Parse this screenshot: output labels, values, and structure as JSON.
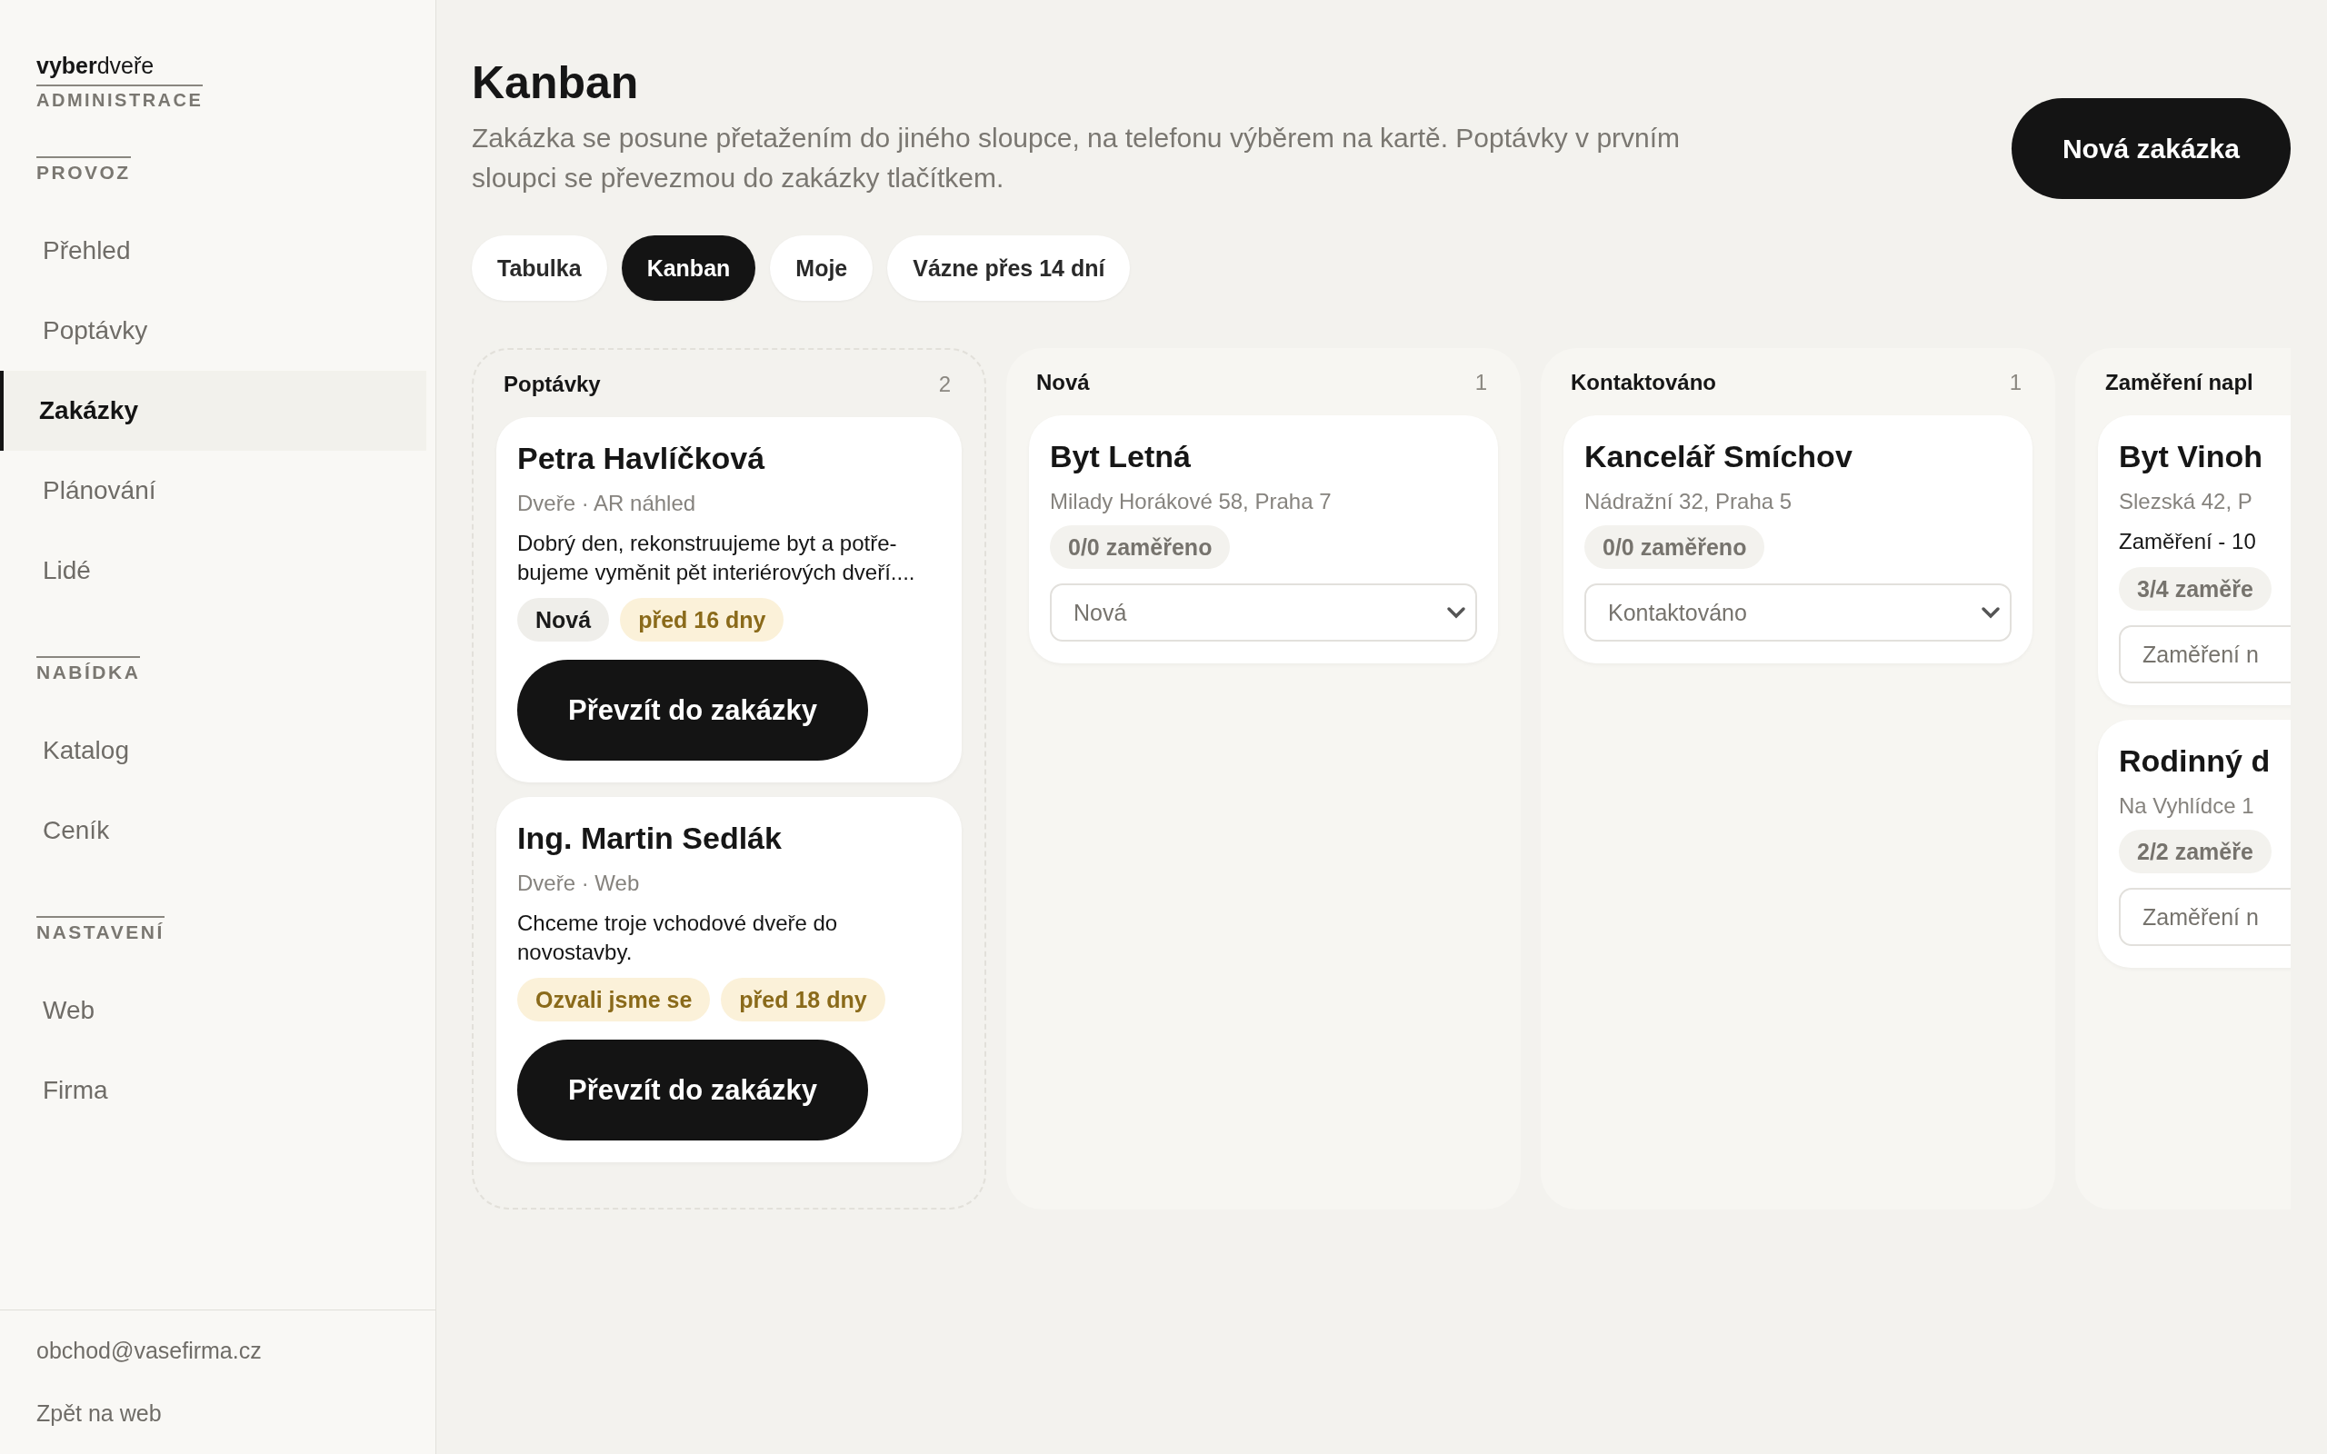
{
  "sidebar": {
    "logo": "**vyber**dveře",
    "logo_subtitle": "ADMINISTRACE",
    "sections": [
      {
        "title": "PROVOZ",
        "items": [
          {
            "label": "Přehled",
            "selected": false
          },
          {
            "label": "Poptávky",
            "selected": false
          },
          {
            "label": "Zakázky",
            "selected": true
          },
          {
            "label": "Plánování",
            "selected": false
          },
          {
            "label": "Lidé",
            "selected": false
          }
        ]
      },
      {
        "title": "NABÍDKA",
        "items": [
          {
            "label": "Katalog",
            "selected": false
          },
          {
            "label": "Ceník",
            "selected": false
          }
        ]
      },
      {
        "title": "NASTAVENÍ",
        "items": [
          {
            "label": "Web",
            "selected": false
          },
          {
            "label": "Firma",
            "selected": false
          }
        ]
      }
    ],
    "footer": {
      "email": "obchod@vasefirma.cz",
      "back_link": "Zpět na web"
    }
  },
  "header": {
    "title": "Kanban",
    "description": "Zakázka se posune přetažením do jiného sloupce, na telefonu výběrem na kartě. Poptávky v prvním sloupci se převezmou do zakázky tlačítkem.",
    "primary_button": "Nová zakázka"
  },
  "tabs": [
    {
      "label": "Tabulka",
      "selected": false
    },
    {
      "label": "Kanban",
      "selected": true
    },
    {
      "label": "Moje",
      "selected": false
    },
    {
      "label": "Vázne přes 14 dní",
      "selected": false
    }
  ],
  "columns": [
    {
      "kind": "inbox",
      "title": "Poptávky",
      "count": "2",
      "cards": [
        {
          "kind": "inquiry",
          "title": "Petra Havlíčková",
          "meta": "Dveře · AR náhled",
          "message": "Dobrý den, rekonstruujeme byt a potře-bujeme vyměnit pět interiérových dveří....",
          "tags": [
            {
              "label": "Nová",
              "kind": "neutral"
            },
            {
              "label": "před 16 dny",
              "kind": "warm"
            }
          ],
          "button": "Převzít do zakázky"
        },
        {
          "kind": "inquiry",
          "title": "Ing. Martin Sedlák",
          "meta": "Dveře · Web",
          "message": "Chceme troje vchodové dveře do novostavby.",
          "tags": [
            {
              "label": "Ozvali jsme se",
              "kind": "warm"
            },
            {
              "label": "před 18 dny",
              "kind": "warm"
            }
          ],
          "button": "Převzít do zakázky"
        }
      ]
    },
    {
      "kind": "stage",
      "title": "Nová",
      "count": "1",
      "cards": [
        {
          "kind": "job",
          "title": "Byt Letná",
          "meta": "Milady Horákové 58, Praha 7",
          "tags": [
            {
              "label": "0/0 zaměřeno",
              "kind": "muted"
            }
          ],
          "status": "Nová"
        }
      ]
    },
    {
      "kind": "stage",
      "title": "Kontaktováno",
      "count": "1",
      "cards": [
        {
          "kind": "job",
          "title": "Kancelář Smíchov",
          "meta": "Nádražní 32, Praha 5",
          "tags": [
            {
              "label": "0/0 zaměřeno",
              "kind": "muted"
            }
          ],
          "status": "Kontaktováno"
        }
      ]
    },
    {
      "kind": "stage",
      "title": "Zaměření napl",
      "cards": [
        {
          "kind": "job",
          "title": "Byt Vinoh",
          "meta": "Slezská 42, P",
          "message": "Zaměření - 10",
          "tags": [
            {
              "label": "3/4 zaměře",
              "kind": "muted"
            }
          ],
          "status": "Zaměření n"
        },
        {
          "kind": "job",
          "title": "Rodinný d",
          "meta": "Na Vyhlídce 1",
          "tags": [
            {
              "label": "2/2 zaměře",
              "kind": "muted"
            }
          ],
          "status": "Zaměření n"
        }
      ]
    }
  ]
}
